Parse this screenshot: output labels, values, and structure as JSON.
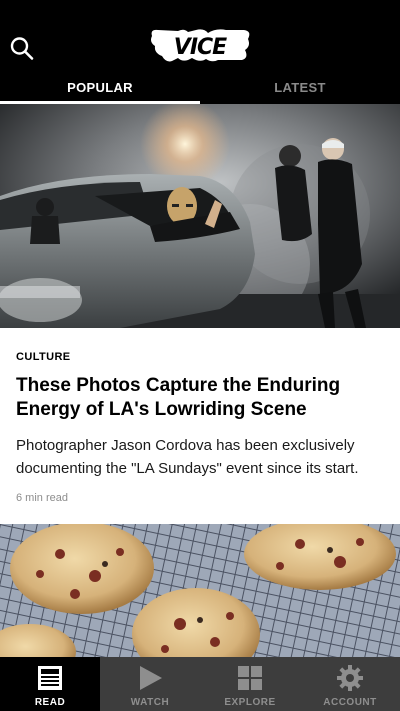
{
  "header": {
    "logo_text": "VICE",
    "search_icon": "search-icon",
    "tabs": [
      {
        "label": "POPULAR",
        "active": true
      },
      {
        "label": "LATEST",
        "active": false
      }
    ]
  },
  "feed": {
    "articles": [
      {
        "category": "CULTURE",
        "headline": "These Photos Capture the Enduring Energy of LA's Lowriding Scene",
        "summary": "Photographer Jason Cordova has been exclusively documenting the \"LA Sundays\" event since its start.",
        "read_time": "6 min read"
      }
    ]
  },
  "bottom_nav": {
    "items": [
      {
        "label": "READ",
        "icon": "read-icon",
        "active": true
      },
      {
        "label": "WATCH",
        "icon": "play-icon",
        "active": false
      },
      {
        "label": "EXPLORE",
        "icon": "grid-icon",
        "active": false
      },
      {
        "label": "ACCOUNT",
        "icon": "gear-icon",
        "active": false
      }
    ]
  },
  "colors": {
    "header_bg": "#000000",
    "nav_bg": "#3d3d3d",
    "nav_active_bg": "#000000",
    "muted_text": "#8d8d8d"
  }
}
